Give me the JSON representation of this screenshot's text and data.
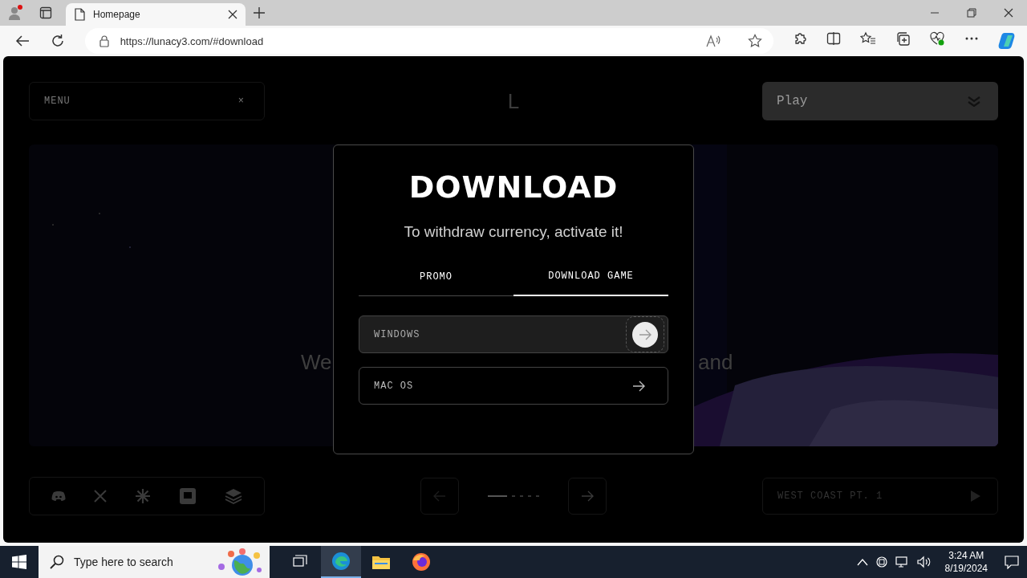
{
  "browser": {
    "tabs": [
      {
        "title": "Homepage",
        "selected": true
      }
    ],
    "url": "https://lunacy3.com/#download"
  },
  "page": {
    "menu": {
      "label": "MENU",
      "close": "×"
    },
    "logo": "L",
    "play_select": {
      "value": "Play"
    },
    "hero": {
      "text_left": "We",
      "text_right": "and"
    },
    "pager": [
      {
        "selected": true
      },
      {
        "selected": false
      },
      {
        "selected": false
      },
      {
        "selected": false
      },
      {
        "selected": false
      }
    ],
    "track": {
      "title": "WEST COAST PT. 1"
    }
  },
  "modal": {
    "title": "DOWNLOAD",
    "subtitle": "To withdraw currency, activate it!",
    "tabs": [
      {
        "label": "PROMO",
        "selected": false
      },
      {
        "label": "DOWNLOAD GAME",
        "selected": true
      }
    ],
    "options": [
      {
        "label": "WINDOWS",
        "highlighted": true
      },
      {
        "label": "MAC OS",
        "highlighted": false
      }
    ]
  },
  "taskbar": {
    "search_placeholder": "Type here to search",
    "apps": [
      {
        "kind": "taskview",
        "selected": false
      },
      {
        "kind": "edge",
        "selected": true
      },
      {
        "kind": "explorer",
        "selected": false
      },
      {
        "kind": "firefox",
        "selected": false
      }
    ],
    "time": "3:24 AM",
    "date": "8/19/2024"
  }
}
